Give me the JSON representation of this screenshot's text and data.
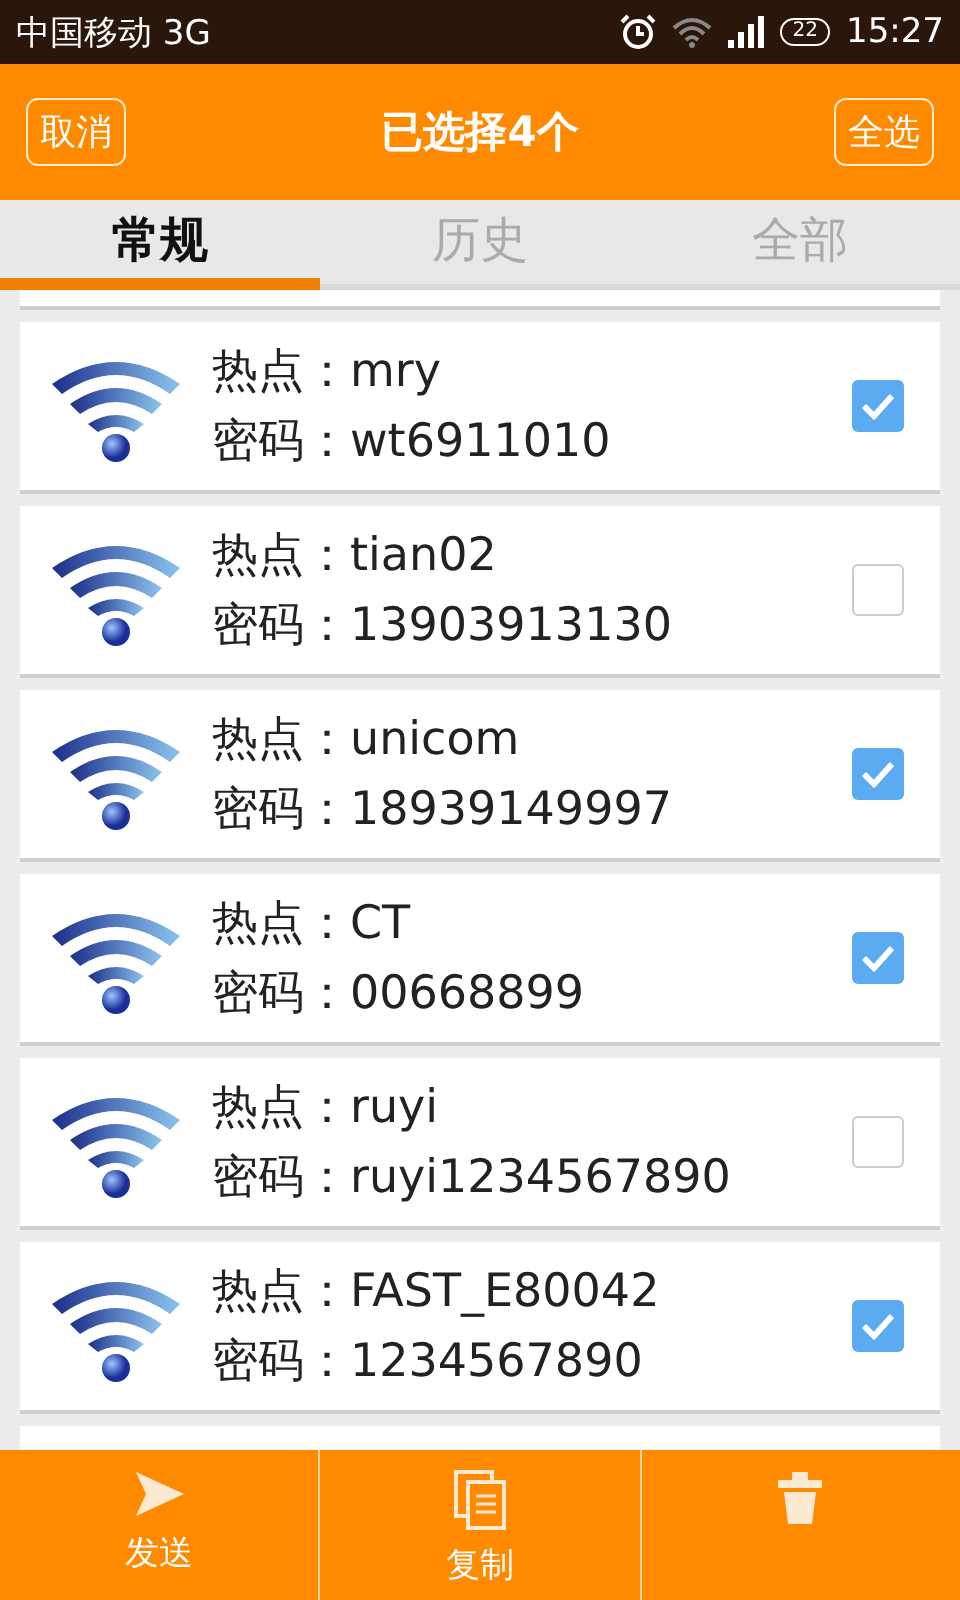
{
  "status_bar": {
    "carrier": "中国移动 3G",
    "battery": "22",
    "time": "15:27"
  },
  "header": {
    "cancel": "取消",
    "title": "已选择4个",
    "select_all": "全选"
  },
  "tabs": [
    {
      "label": "常规",
      "selected": true
    },
    {
      "label": "历史",
      "selected": false
    },
    {
      "label": "全部",
      "selected": false
    }
  ],
  "hotspots": [
    {
      "hotspot": "热点：mry",
      "password": "密码：wt6911010",
      "checked": true
    },
    {
      "hotspot": "热点：tian02",
      "password": "密码：13903913130",
      "checked": false
    },
    {
      "hotspot": "热点：unicom",
      "password": "密码：18939149997",
      "checked": true
    },
    {
      "hotspot": "热点：CT",
      "password": "密码：00668899",
      "checked": true
    },
    {
      "hotspot": "热点：ruyi",
      "password": "密码：ruyi1234567890",
      "checked": false
    },
    {
      "hotspot": "热点：FAST_E80042",
      "password": "密码：1234567890",
      "checked": true
    }
  ],
  "actions": [
    {
      "kind": "send",
      "label": "发送"
    },
    {
      "kind": "copy",
      "label": "复制"
    },
    {
      "kind": "delete"
    }
  ]
}
